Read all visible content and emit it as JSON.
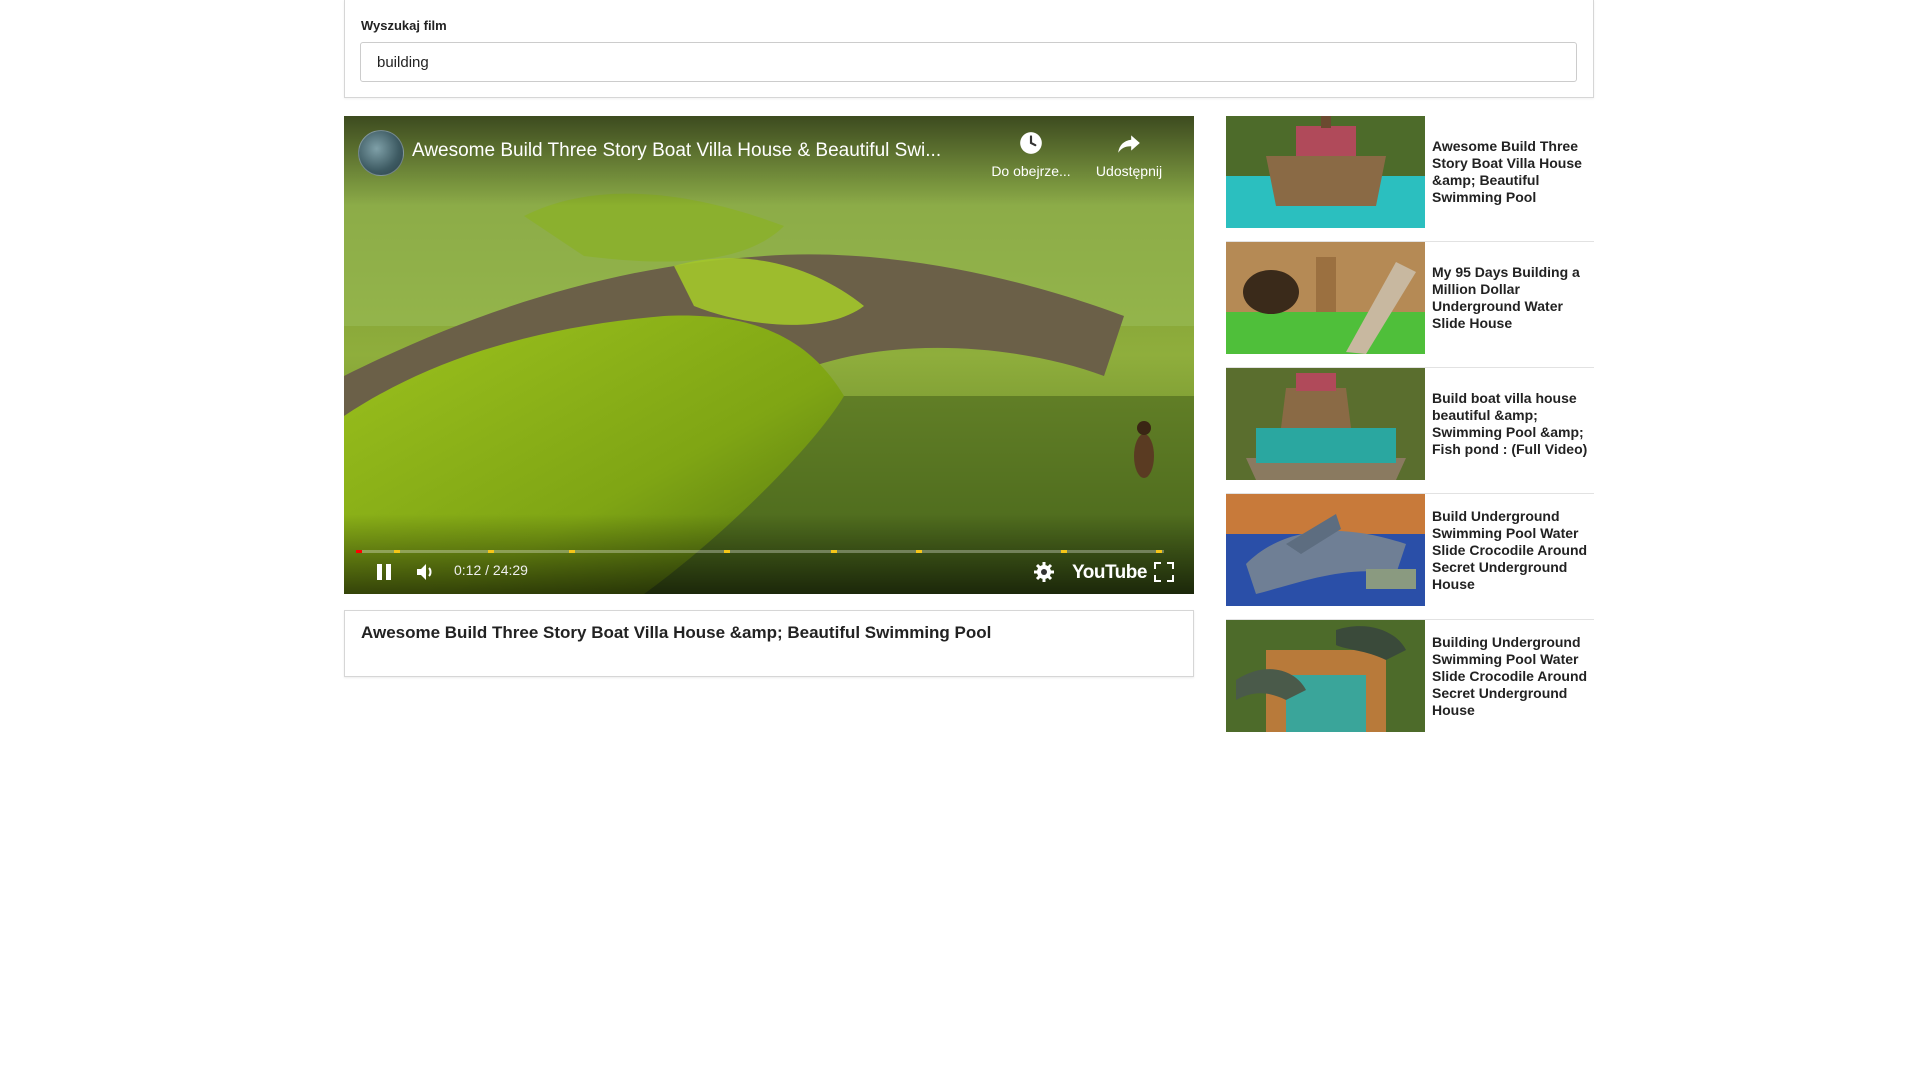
{
  "search": {
    "label": "Wyszukaj film",
    "value": "building"
  },
  "player": {
    "overlay_title": "Awesome Build Three Story Boat Villa House & Beautiful Swi...",
    "watch_later_label": "Do obejrze...",
    "share_label": "Udostępnij",
    "time_display": "0:12 / 24:29",
    "logo_text": "YouTube",
    "progress_fraction": 0.008,
    "icons": {
      "pause": "pause-icon",
      "volume": "volume-icon",
      "settings": "gear-icon",
      "fullscreen": "fullscreen-icon",
      "watch_later": "clock-icon",
      "share": "share-arrow-icon"
    }
  },
  "video_title": "Awesome Build Three Story Boat Villa House &amp; Beautiful Swimming Pool",
  "sidebar": {
    "items": [
      {
        "title": "Awesome Build Three Story Boat Villa House &amp; Beautiful Swimming Pool"
      },
      {
        "title": "My 95 Days Building a Million Dollar Underground Water Slide House"
      },
      {
        "title": "Build boat villa house beautiful &amp; Swimming Pool &amp; Fish pond : (Full Video)"
      },
      {
        "title": "Build Underground Swimming Pool Water Slide Crocodile Around Secret Underground House"
      },
      {
        "title": "Building Underground Swimming Pool Water Slide Crocodile Around Secret Underground House"
      }
    ]
  },
  "colors": {
    "progress_played": "#ff0000",
    "ad_marker": "#f5c518",
    "border": "#d6d6d6"
  }
}
